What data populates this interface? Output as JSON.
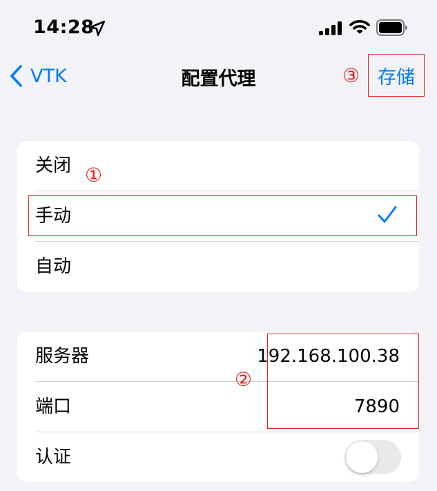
{
  "status_bar": {
    "time": "14:28",
    "icons": [
      "location-arrow-icon",
      "cellular-signal-icon",
      "wifi-icon",
      "battery-icon"
    ]
  },
  "nav": {
    "back_label": "VTK",
    "title": "配置代理",
    "save_label": "存储"
  },
  "annotations": {
    "one": "①",
    "two": "②",
    "three": "③",
    "color": "#e52222"
  },
  "mode_options": [
    {
      "label": "关闭",
      "selected": false
    },
    {
      "label": "手动",
      "selected": true
    },
    {
      "label": "自动",
      "selected": false
    }
  ],
  "manual_settings": {
    "server_label": "服务器",
    "server_value": "192.168.100.38",
    "port_label": "端口",
    "port_value": "7890",
    "auth_label": "认证",
    "auth_enabled": false
  },
  "colors": {
    "accent": "#007aff",
    "background": "#f2f2f7",
    "annotation": "#e52222"
  }
}
